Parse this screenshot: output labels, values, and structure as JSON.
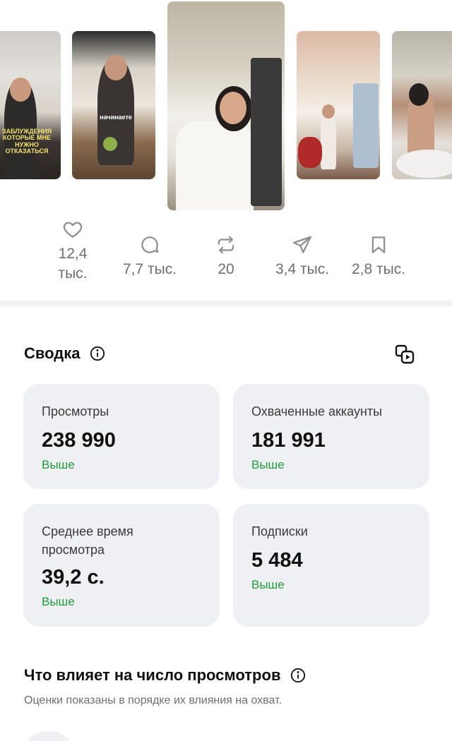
{
  "actions": {
    "likes": "12,4 тыс.",
    "comments": "7,7 тыс.",
    "reposts": "20",
    "shares": "3,4 тыс.",
    "saves": "2,8 тыс."
  },
  "thumbnails": {
    "thumb1_caption": "заблуждения которые мне нужно отказаться",
    "thumb2_caption": "начинаете"
  },
  "summary": {
    "title": "Сводка",
    "cards": [
      {
        "label": "Просмотры",
        "value": "238 990",
        "trend": "Выше"
      },
      {
        "label": "Охваченные аккаунты",
        "value": "181 991",
        "trend": "Выше"
      },
      {
        "label": "Среднее время просмотра",
        "value": "39,2 с.",
        "trend": "Выше"
      },
      {
        "label": "Подписки",
        "value": "5 484",
        "trend": "Выше"
      }
    ]
  },
  "influence": {
    "title": "Что влияет на число просмотров",
    "subtitle": "Оценки показаны в порядке их влияния на охват."
  },
  "colors": {
    "trend_green": "#1f9b3a",
    "card_bg": "#eff0f3",
    "muted_text": "#6e6e73"
  },
  "icons": [
    "heart-icon",
    "comment-icon",
    "repost-icon",
    "share-icon",
    "bookmark-icon",
    "info-icon",
    "copy-clip-icon"
  ]
}
